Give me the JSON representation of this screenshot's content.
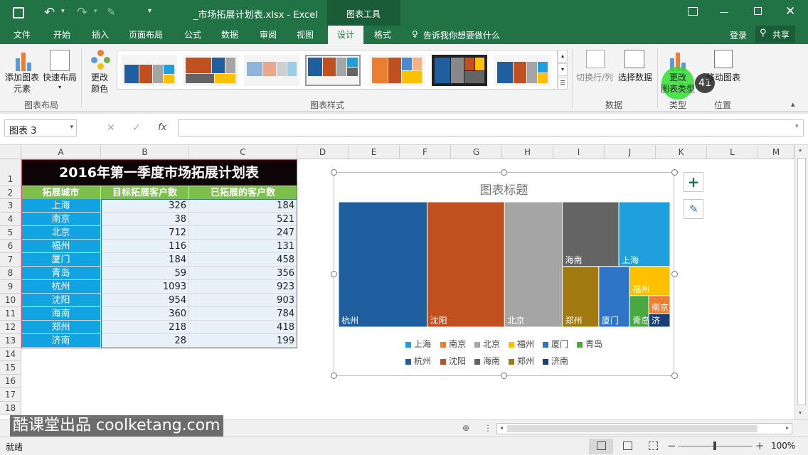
{
  "window": {
    "title": "_市场拓展计划表.xlsx - Excel",
    "tools": "图表工具"
  },
  "tabs": [
    "文件",
    "开始",
    "插入",
    "页面布局",
    "公式",
    "数据",
    "审阅",
    "视图",
    "设计",
    "格式"
  ],
  "tellme": "告诉我你想要做什么",
  "login": "登录",
  "share": "共享",
  "ribbon": {
    "add_element": "添加图表",
    "add_element2": "元素",
    "quick_layout": "快速布局",
    "change_colors": "更改",
    "change_colors2": "颜色",
    "group_layout": "图表布局",
    "group_styles": "图表样式",
    "switch": "切换行/列",
    "select_data": "选择数据",
    "group_data": "数据",
    "change_type": "更改",
    "change_type2": "图表类型",
    "group_type": "类型",
    "move_chart": "移动图表",
    "group_location": "位置",
    "step_badge": "41"
  },
  "formula": {
    "name_box": "图表 3",
    "fx": "fx",
    "value": ""
  },
  "columns": [
    "A",
    "B",
    "C",
    "D",
    "E",
    "F",
    "G",
    "H",
    "I",
    "J",
    "K",
    "L",
    "M"
  ],
  "rows": [
    "1",
    "2",
    "3",
    "4",
    "5",
    "6",
    "7",
    "8",
    "9",
    "10",
    "11",
    "12",
    "13",
    "14",
    "15",
    "16",
    "17",
    "18"
  ],
  "sheet": {
    "title": "2016年第一季度市场拓展计划表",
    "headers": [
      "拓展城市",
      "目标拓展客户数",
      "已拓展的客户数"
    ],
    "data": [
      [
        "上海",
        "326",
        "184"
      ],
      [
        "南京",
        "38",
        "521"
      ],
      [
        "北京",
        "712",
        "247"
      ],
      [
        "福州",
        "116",
        "131"
      ],
      [
        "厦门",
        "184",
        "458"
      ],
      [
        "青岛",
        "59",
        "356"
      ],
      [
        "杭州",
        "1093",
        "923"
      ],
      [
        "沈阳",
        "954",
        "903"
      ],
      [
        "海南",
        "360",
        "784"
      ],
      [
        "郑州",
        "218",
        "418"
      ],
      [
        "济南",
        "28",
        "199"
      ]
    ]
  },
  "chart": {
    "title": "图表标题",
    "tiles": [
      "杭州",
      "沈阳",
      "北京",
      "海南",
      "上海",
      "郑州",
      "厦门",
      "福州",
      "青岛",
      "南京",
      "济"
    ],
    "legend": [
      "上海",
      "南京",
      "北京",
      "福州",
      "厦门",
      "青岛",
      "杭州",
      "沈阳",
      "海南",
      "郑州",
      "济南"
    ]
  },
  "chart_data": {
    "type": "treemap",
    "categories": [
      "上海",
      "南京",
      "北京",
      "福州",
      "厦门",
      "青岛",
      "杭州",
      "沈阳",
      "海南",
      "郑州",
      "济南"
    ],
    "values": [
      326,
      38,
      712,
      116,
      184,
      59,
      1093,
      954,
      360,
      218,
      28
    ],
    "title": "图表标题"
  },
  "colors": {
    "excel_green": "#217346",
    "上海": "#1f9fdc",
    "南京": "#ed7d31",
    "北京": "#a5a5a5",
    "福州": "#ffc000",
    "厦门": "#2e75c8",
    "青岛": "#4aa840",
    "杭州": "#1f5fa0",
    "沈阳": "#c0501f",
    "海南": "#646464",
    "郑州": "#a07a10",
    "济南": "#1a3f78"
  },
  "watermark": "酷课堂出品 coolketang.com",
  "status": {
    "ready": "就绪",
    "zoom": "100%"
  }
}
